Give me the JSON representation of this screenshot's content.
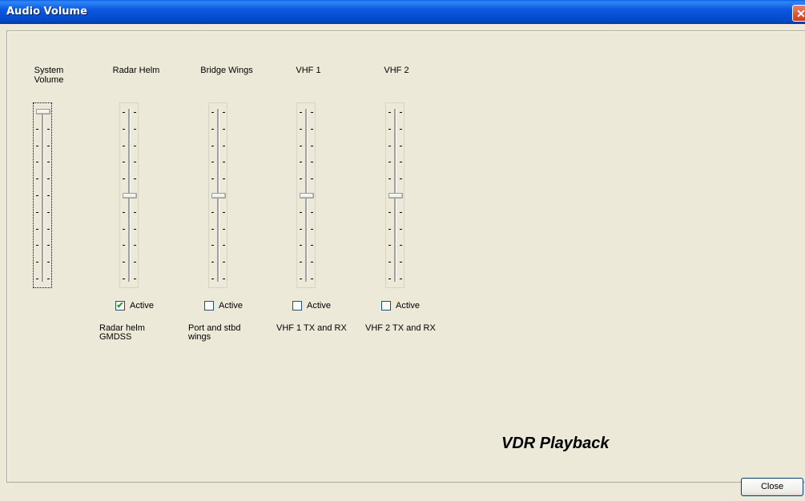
{
  "window": {
    "title": "Audio Volume",
    "close_glyph": "✕"
  },
  "channels": [
    {
      "label": "System\nVolume",
      "level": 1.0
    },
    {
      "label": "Radar Helm",
      "level": 0.5,
      "checkbox": {
        "label": "Active",
        "checked": true
      },
      "description": "Radar helm\nGMDSS"
    },
    {
      "label": "Bridge Wings",
      "level": 0.5,
      "checkbox": {
        "label": "Active",
        "checked": false
      },
      "description": "Port and stbd\nwings"
    },
    {
      "label": "VHF 1",
      "level": 0.5,
      "checkbox": {
        "label": "Active",
        "checked": false
      },
      "description": "VHF 1 TX and RX"
    },
    {
      "label": "VHF 2",
      "level": 0.5,
      "checkbox": {
        "label": "Active",
        "checked": false
      },
      "description": "VHF 2 TX and RX"
    }
  ],
  "brand": "VDR Playback",
  "footer": {
    "close_label": "Close"
  }
}
